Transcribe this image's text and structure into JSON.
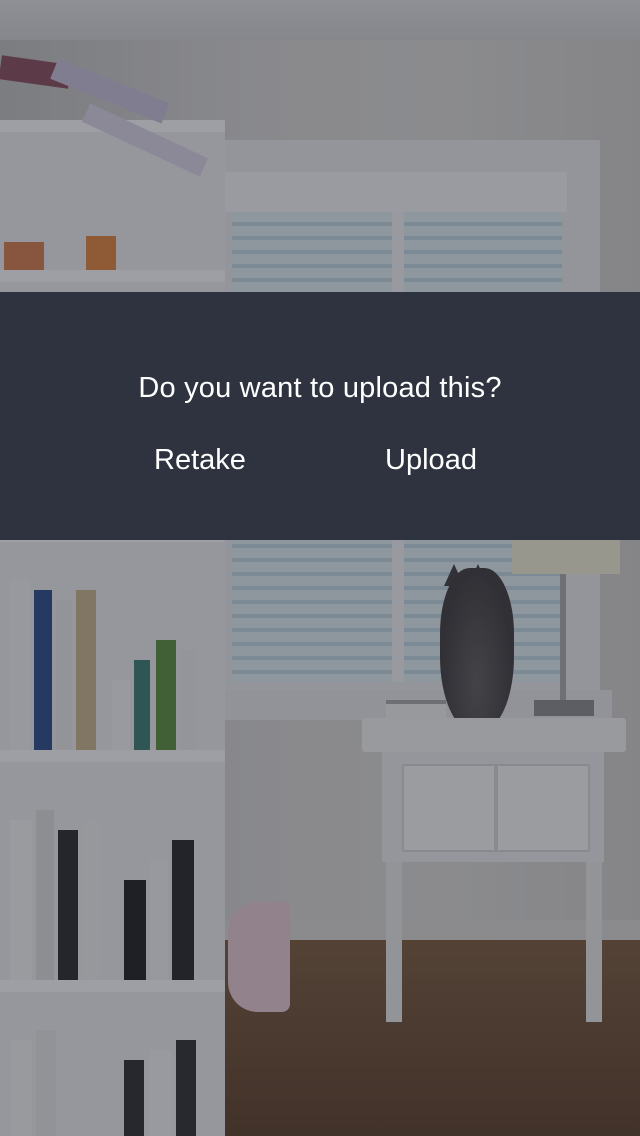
{
  "dialog": {
    "question": "Do you want to upload this?",
    "retake_label": "Retake",
    "upload_label": "Upload"
  },
  "colors": {
    "dialog_background": "#2f3340",
    "dialog_text": "#ffffff"
  }
}
